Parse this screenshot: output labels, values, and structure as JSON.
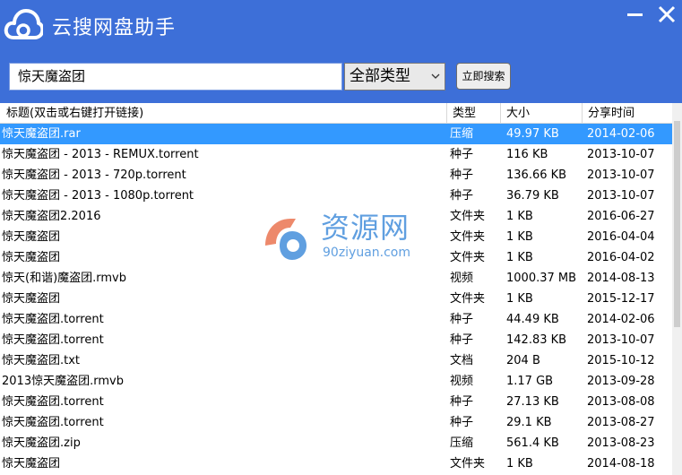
{
  "app": {
    "title": "云搜网盘助手",
    "brand_color": "#3d6fd8",
    "minimize_icon": "minimize-icon",
    "close_icon": "close-icon"
  },
  "search": {
    "query": "惊天魔盗团",
    "type_selected": "全部类型",
    "button_label": "立即搜索"
  },
  "table": {
    "headers": {
      "title": "标题(双击或右键打开链接)",
      "type": "类型",
      "size": "大小",
      "time": "分享时间"
    },
    "selected_color": "#3399ff",
    "rows": [
      {
        "name": "惊天魔盗团.rar",
        "type": "压缩",
        "size": "49.97 KB",
        "time": "2014-02-06"
      },
      {
        "name": "惊天魔盗团 - 2013 - REMUX.torrent",
        "type": "种子",
        "size": "116 KB",
        "time": "2013-10-07"
      },
      {
        "name": "惊天魔盗团 - 2013 - 720p.torrent",
        "type": "种子",
        "size": "136.66 KB",
        "time": "2013-10-07"
      },
      {
        "name": "惊天魔盗团 - 2013 - 1080p.torrent",
        "type": "种子",
        "size": "36.79 KB",
        "time": "2013-10-07"
      },
      {
        "name": "惊天魔盗团2.2016",
        "type": "文件夹",
        "size": "1 KB",
        "time": "2016-06-27"
      },
      {
        "name": "惊天魔盗团",
        "type": "文件夹",
        "size": "1 KB",
        "time": "2016-04-04"
      },
      {
        "name": "惊天魔盗团",
        "type": "文件夹",
        "size": "1 KB",
        "time": "2016-04-02"
      },
      {
        "name": "惊天(和谐)魔盗团.rmvb",
        "type": "视频",
        "size": "1000.37 MB",
        "time": "2014-08-13"
      },
      {
        "name": "惊天魔盗团",
        "type": "文件夹",
        "size": "1 KB",
        "time": "2015-12-17"
      },
      {
        "name": "惊天魔盗团.torrent",
        "type": "种子",
        "size": "44.49 KB",
        "time": "2014-02-06"
      },
      {
        "name": "惊天魔盗团.torrent",
        "type": "种子",
        "size": "142.83 KB",
        "time": "2013-10-07"
      },
      {
        "name": "惊天魔盗团.txt",
        "type": "文档",
        "size": "204 B",
        "time": "2015-10-12"
      },
      {
        "name": "2013惊天魔盗团.rmvb",
        "type": "视频",
        "size": "1.17 GB",
        "time": "2013-09-28"
      },
      {
        "name": "惊天魔盗团.torrent",
        "type": "种子",
        "size": "27.13 KB",
        "time": "2013-08-08"
      },
      {
        "name": "惊天魔盗团.torrent",
        "type": "种子",
        "size": "29.1 KB",
        "time": "2013-08-27"
      },
      {
        "name": "惊天魔盗团.zip",
        "type": "压缩",
        "size": "561.4 KB",
        "time": "2013-08-23"
      },
      {
        "name": "惊天魔盗团",
        "type": "文件夹",
        "size": "1 KB",
        "time": "2014-08-18"
      }
    ]
  },
  "watermark": {
    "text": "资源网",
    "url": "90ziyuan.com"
  }
}
